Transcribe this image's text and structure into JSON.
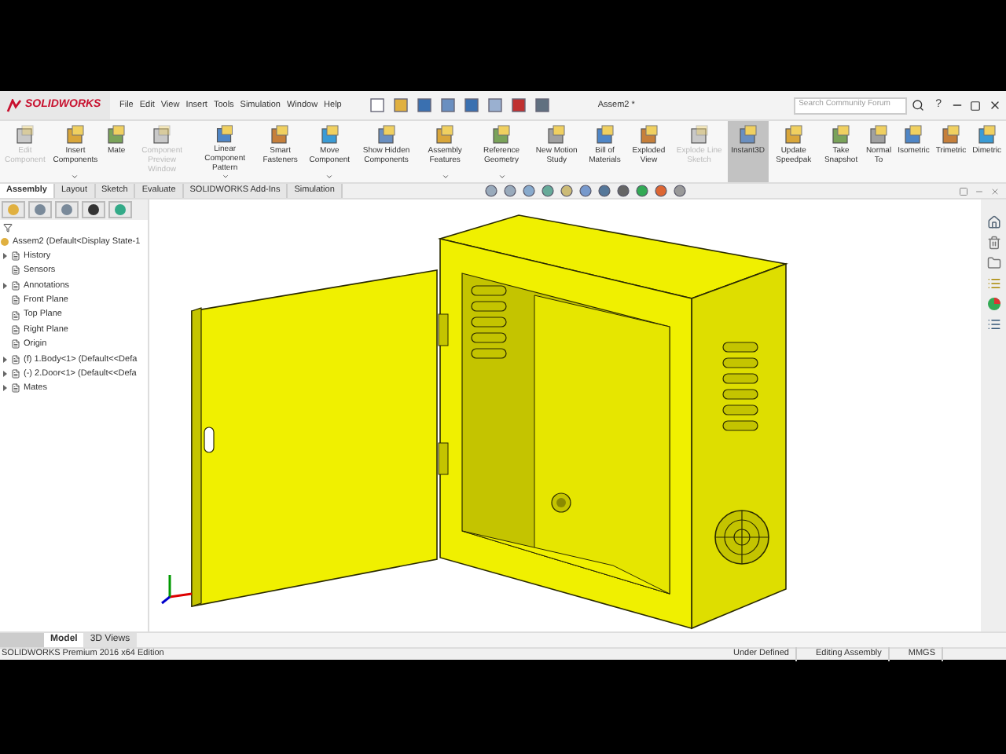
{
  "app": {
    "logo": "SOLIDWORKS",
    "menu": [
      "File",
      "Edit",
      "View",
      "Insert",
      "Tools",
      "Simulation",
      "Window",
      "Help"
    ],
    "document_title": "Assem2 *",
    "search": {
      "placeholder": "Search Community Forum"
    },
    "help": "?"
  },
  "ribbon": [
    {
      "label": "Edit Component",
      "disabled": true,
      "selected": false,
      "dropdown": false
    },
    {
      "label": "Insert Components",
      "disabled": false,
      "selected": false,
      "dropdown": true
    },
    {
      "label": "Mate",
      "disabled": false,
      "selected": false,
      "dropdown": false
    },
    {
      "label": "Component Preview Window",
      "disabled": true,
      "selected": false,
      "dropdown": false
    },
    {
      "label": "Linear Component Pattern",
      "disabled": false,
      "selected": false,
      "dropdown": true
    },
    {
      "label": "Smart Fasteners",
      "disabled": false,
      "selected": false,
      "dropdown": false
    },
    {
      "label": "Move Component",
      "disabled": false,
      "selected": false,
      "dropdown": true
    },
    {
      "label": "Show Hidden Components",
      "disabled": false,
      "selected": false,
      "dropdown": false
    },
    {
      "label": "Assembly Features",
      "disabled": false,
      "selected": false,
      "dropdown": true
    },
    {
      "label": "Reference Geometry",
      "disabled": false,
      "selected": false,
      "dropdown": true
    },
    {
      "label": "New Motion Study",
      "disabled": false,
      "selected": false,
      "dropdown": false
    },
    {
      "label": "Bill of Materials",
      "disabled": false,
      "selected": false,
      "dropdown": false
    },
    {
      "label": "Exploded View",
      "disabled": false,
      "selected": false,
      "dropdown": false
    },
    {
      "label": "Explode Line Sketch",
      "disabled": true,
      "selected": false,
      "dropdown": false
    },
    {
      "label": "Instant3D",
      "disabled": false,
      "selected": true,
      "dropdown": false
    },
    {
      "label": "Update Speedpak",
      "disabled": false,
      "selected": false,
      "dropdown": false
    },
    {
      "label": "Take Snapshot",
      "disabled": false,
      "selected": false,
      "dropdown": false
    },
    {
      "label": "Normal To",
      "disabled": false,
      "selected": false,
      "dropdown": false
    },
    {
      "label": "Isometric",
      "disabled": false,
      "selected": false,
      "dropdown": false
    },
    {
      "label": "Trimetric",
      "disabled": false,
      "selected": false,
      "dropdown": false
    },
    {
      "label": "Dimetric",
      "disabled": false,
      "selected": false,
      "dropdown": false
    }
  ],
  "tabs": [
    {
      "label": "Assembly",
      "selected": true
    },
    {
      "label": "Layout",
      "selected": false
    },
    {
      "label": "Sketch",
      "selected": false
    },
    {
      "label": "Evaluate",
      "selected": false
    },
    {
      "label": "SOLIDWORKS Add-Ins",
      "selected": false
    },
    {
      "label": "Simulation",
      "selected": false
    }
  ],
  "tree": {
    "root": "Assem2  (Default<Display State-1",
    "items": [
      {
        "label": "History",
        "expanded": false
      },
      {
        "label": "Sensors"
      },
      {
        "label": "Annotations",
        "expanded": false
      },
      {
        "label": "Front Plane"
      },
      {
        "label": "Top Plane"
      },
      {
        "label": "Right Plane"
      },
      {
        "label": "Origin"
      },
      {
        "label": "(f) 1.Body<1> (Default<<Defa",
        "expanded": false
      },
      {
        "label": "(-) 2.Door<1> (Default<<Defa",
        "expanded": false
      },
      {
        "label": "Mates",
        "expanded": false
      }
    ]
  },
  "bottom_tabs": [
    {
      "label": "Model",
      "selected": true
    },
    {
      "label": "3D Views",
      "selected": false
    }
  ],
  "status_bar": {
    "edition": "SOLIDWORKS Premium 2016 x64 Edition",
    "fields": [
      "Under Defined",
      "Editing Assembly",
      "MMGS"
    ]
  }
}
